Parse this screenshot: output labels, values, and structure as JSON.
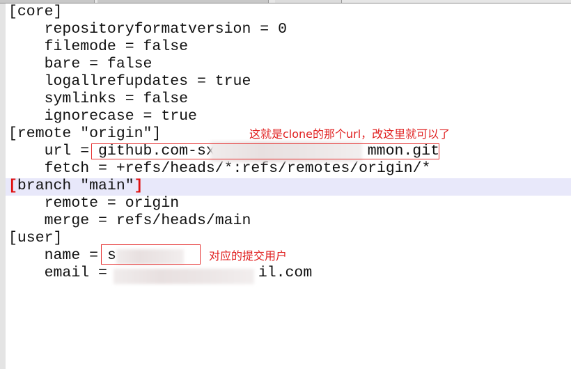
{
  "lines": {
    "core": "[core]",
    "repo": "    repositoryformatversion = 0",
    "filemode": "    filemode = false",
    "bare": "    bare = false",
    "logall": "    logallrefupdates = true",
    "symlinks": "    symlinks = false",
    "ignorecase": "    ignorecase = true",
    "remote": "[remote \"origin\"]",
    "url_prefix": "    url = ",
    "url_start": "github.com-sx",
    "url_end": "mmon.git",
    "fetch": "    fetch = +refs/heads/*:refs/remotes/origin/*",
    "branch_open": "[",
    "branch_name": "branch \"main\"",
    "branch_close": "]",
    "bremote": "    remote = origin",
    "merge": "    merge = refs/heads/main",
    "user": "[user]",
    "name_prefix": "    name = ",
    "name_start": "s",
    "email_prefix": "    email = ",
    "email_end": "il.com"
  },
  "annotations": {
    "url_note": "这就是clone的那个url，改这里就可以了",
    "name_note": "对应的提交用户"
  },
  "colors": {
    "annotation": "#e02020",
    "highlight": "#e8e8fa"
  }
}
